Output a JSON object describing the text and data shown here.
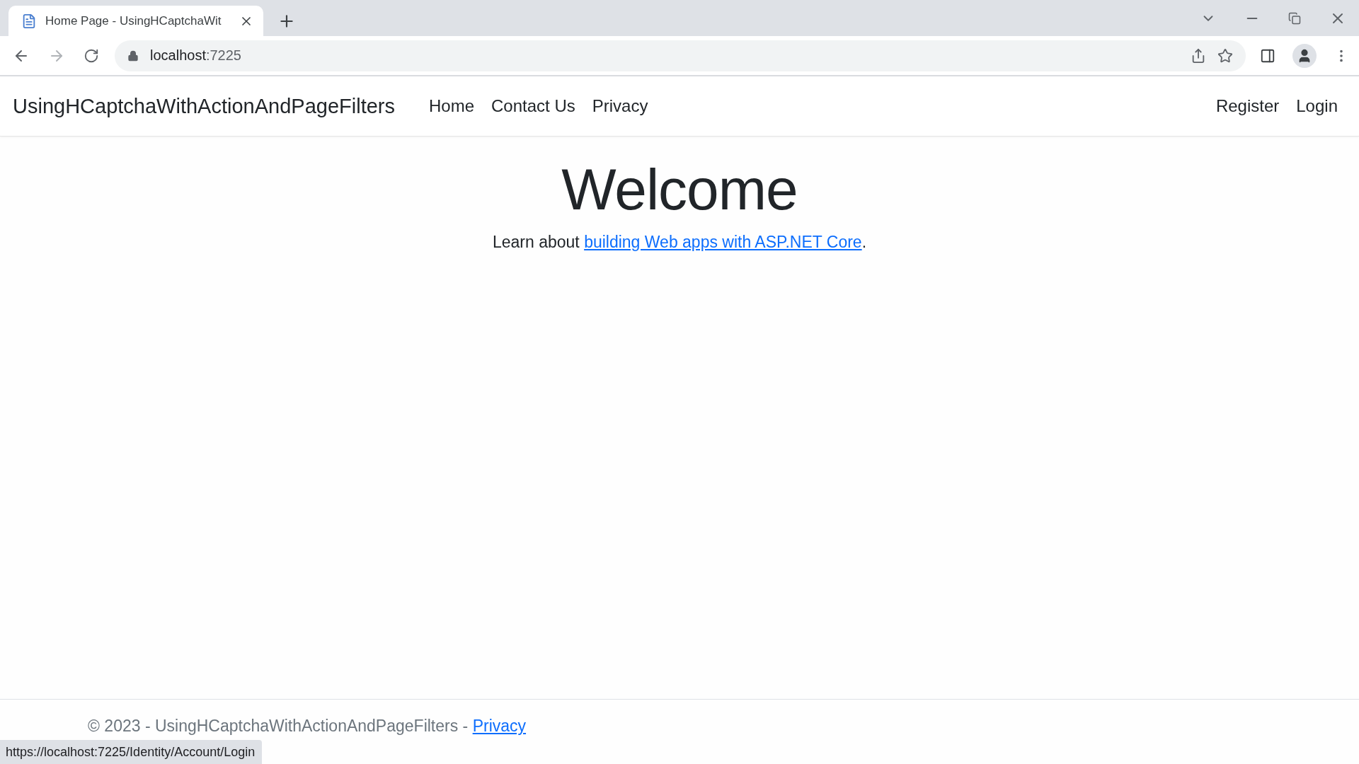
{
  "browser": {
    "tabs": [
      {
        "title": "Home Page - UsingHCaptchaWit",
        "selected": true
      }
    ],
    "url_host": "localhost",
    "url_port": ":7225",
    "status_url": "https://localhost:7225/Identity/Account/Login"
  },
  "navbar": {
    "brand": "UsingHCaptchaWithActionAndPageFilters",
    "links": [
      {
        "label": "Home"
      },
      {
        "label": "Contact Us"
      },
      {
        "label": "Privacy"
      }
    ],
    "account_links": [
      {
        "label": "Register"
      },
      {
        "label": "Login"
      }
    ]
  },
  "main": {
    "heading": "Welcome",
    "lead": "Learn about ",
    "link": "building Web apps with ASP.NET Core",
    "trail": "."
  },
  "footer": {
    "text": "© 2023 - UsingHCaptchaWithActionAndPageFilters - ",
    "link": "Privacy"
  }
}
